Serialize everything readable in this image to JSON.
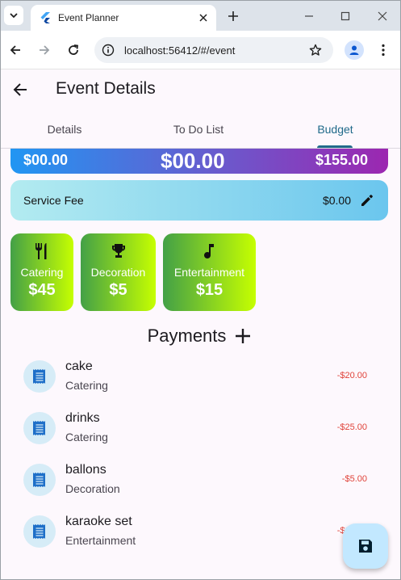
{
  "browser": {
    "tab_title": "Event Planner",
    "url": "localhost:56412/#/event"
  },
  "app": {
    "title": "Event Details",
    "tabs": [
      {
        "label": "Details",
        "active": false
      },
      {
        "label": "To Do List",
        "active": false
      },
      {
        "label": "Budget",
        "active": true
      }
    ],
    "summary": {
      "left_amount": "$00.00",
      "center_amount": "$00.00",
      "right_amount": "$155.00"
    },
    "service_fee": {
      "label": "Service Fee",
      "amount": "$0.00"
    },
    "categories": [
      {
        "name": "Catering",
        "amount": "$45",
        "icon": "restaurant-icon"
      },
      {
        "name": "Decoration",
        "amount": "$5",
        "icon": "trophy-icon"
      },
      {
        "name": "Entertainment",
        "amount": "$15",
        "icon": "music-note-icon"
      }
    ],
    "payments_title": "Payments",
    "payments": [
      {
        "name": "cake",
        "category": "Catering",
        "amount": "-$20.00"
      },
      {
        "name": "drinks",
        "category": "Catering",
        "amount": "-$25.00"
      },
      {
        "name": "ballons",
        "category": "Decoration",
        "amount": "-$5.00"
      },
      {
        "name": "karaoke set",
        "category": "Entertainment",
        "amount": "-$15.00"
      }
    ]
  },
  "colors": {
    "accent": "#206a8a",
    "negative_amount": "#e0443b",
    "fab": "#c2e8ff"
  }
}
